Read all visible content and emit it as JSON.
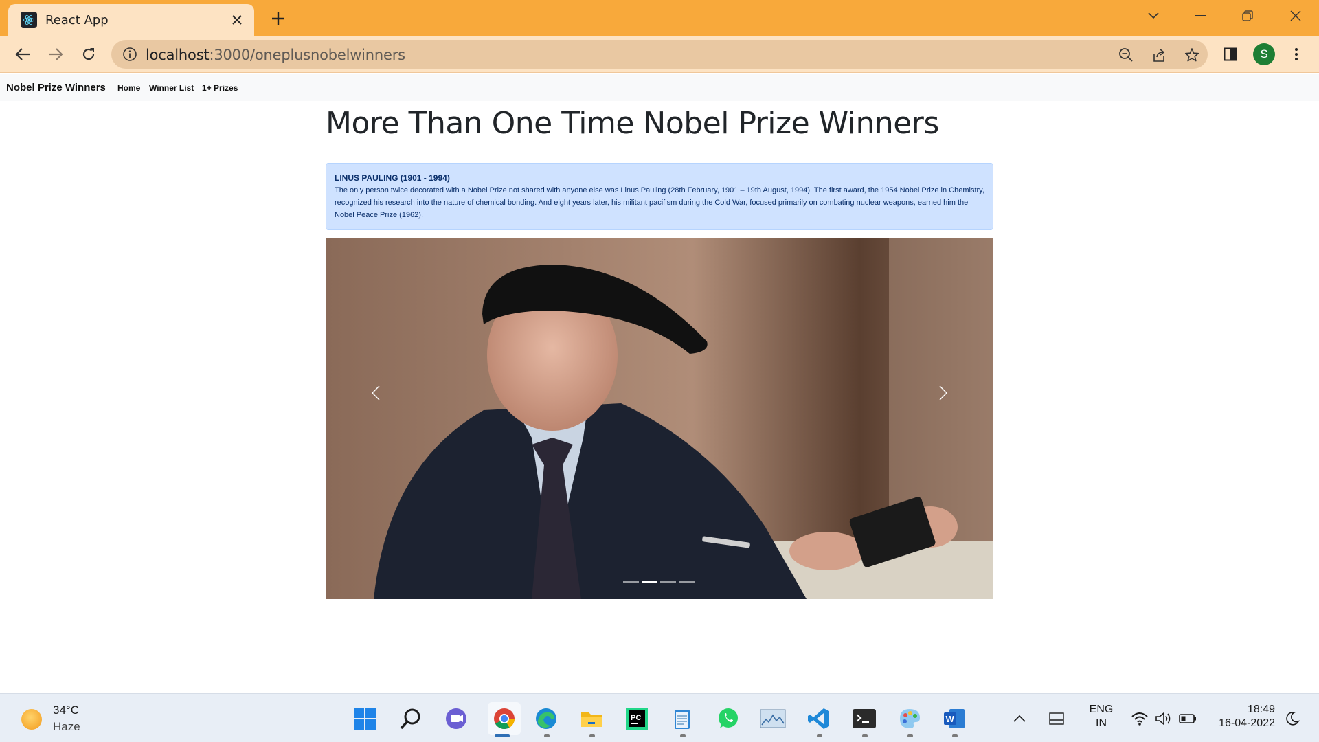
{
  "browser": {
    "tab_title": "React App",
    "url_host": "localhost",
    "url_rest": ":3000/oneplusnobelwinners",
    "profile_initial": "S",
    "theme_color": "#f8a93b",
    "icons": [
      "react-icon",
      "close-icon",
      "plus-icon",
      "chevron-down-icon",
      "minimize-icon",
      "restore-icon",
      "window-close-icon",
      "back-icon",
      "forward-icon",
      "reload-icon",
      "info-icon",
      "zoom-icon",
      "share-icon",
      "star-icon",
      "side-panel-icon",
      "menu-icon"
    ]
  },
  "app_nav": {
    "brand": "Nobel Prize Winners",
    "links": [
      "Home",
      "Winner List",
      "1+ Prizes"
    ]
  },
  "main": {
    "title": "More Than One Time Nobel Prize Winners",
    "alert": {
      "heading": "LINUS PAULING (1901 - 1994)",
      "body": "The only person twice decorated with a Nobel Prize not shared with anyone else was Linus Pauling (28th February, 1901 – 19th August, 1994). The first award, the 1954 Nobel Prize in Chemistry, recognized his research into the nature of chemical bonding. And eight years later, his militant pacifism during the Cold War, focused primarily on combating nuclear weapons, earned him the Nobel Peace Prize (1962).",
      "bg_color": "#cfe2ff"
    },
    "carousel": {
      "slide_count": 4,
      "active_index": 1
    }
  },
  "taskbar": {
    "weather_temp": "34°C",
    "weather_desc": "Haze",
    "lang_top": "ENG",
    "lang_bottom": "IN",
    "time": "18:49",
    "date": "16-04-2022",
    "apps": [
      "windows-start-icon",
      "search-icon",
      "teams-chat-icon",
      "chrome-icon",
      "edge-icon",
      "file-explorer-icon",
      "pycharm-icon",
      "notepad-icon",
      "whatsapp-icon",
      "stock-chart-icon",
      "vscode-icon",
      "terminal-icon",
      "paint-icon",
      "word-icon"
    ]
  }
}
